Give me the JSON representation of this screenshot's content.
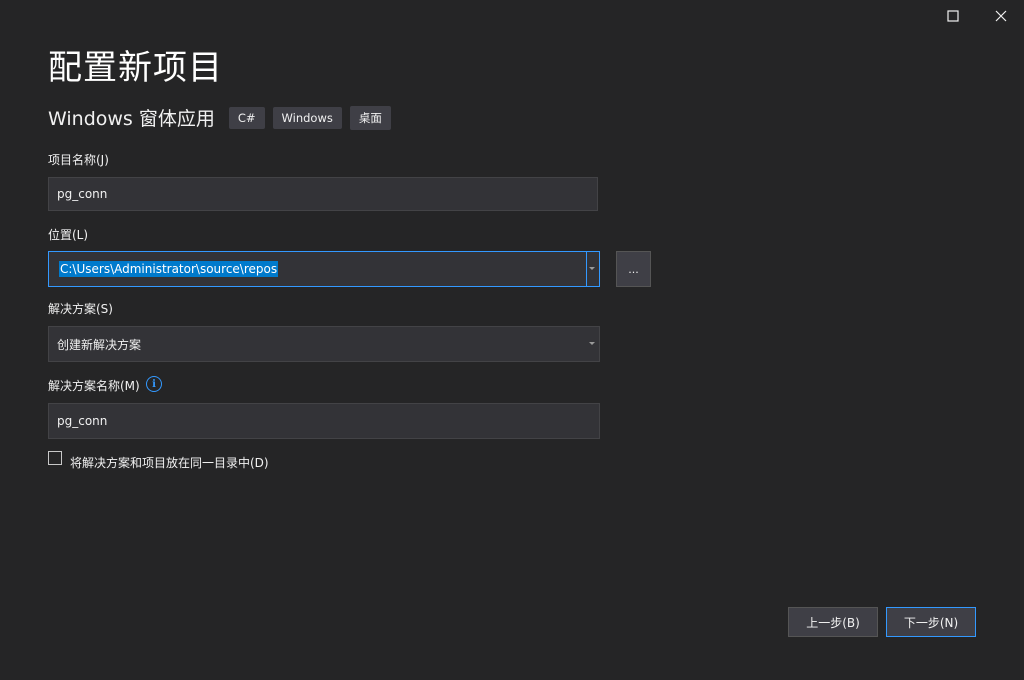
{
  "window": {
    "maximize_icon": "maximize-icon",
    "close_icon": "close-icon"
  },
  "page": {
    "title": "配置新项目",
    "template_name": "Windows 窗体应用",
    "tags": [
      "C#",
      "Windows",
      "桌面"
    ]
  },
  "form": {
    "project_name": {
      "label": "项目名称(J)",
      "value": "pg_conn"
    },
    "location": {
      "label": "位置(L)",
      "value": "C:\\Users\\Administrator\\source\\repos",
      "browse_label": "..."
    },
    "solution": {
      "label": "解决方案(S)",
      "value": "创建新解决方案"
    },
    "solution_name": {
      "label": "解决方案名称(M)",
      "value": "pg_conn",
      "info_icon": "info-icon"
    },
    "same_dir": {
      "label": "将解决方案和项目放在同一目录中(D)",
      "checked": false
    }
  },
  "footer": {
    "back_label": "上一步(B)",
    "next_label": "下一步(N)"
  },
  "colors": {
    "background": "#252526",
    "field": "#333337",
    "accent": "#3399ff",
    "selection": "#007acc"
  }
}
